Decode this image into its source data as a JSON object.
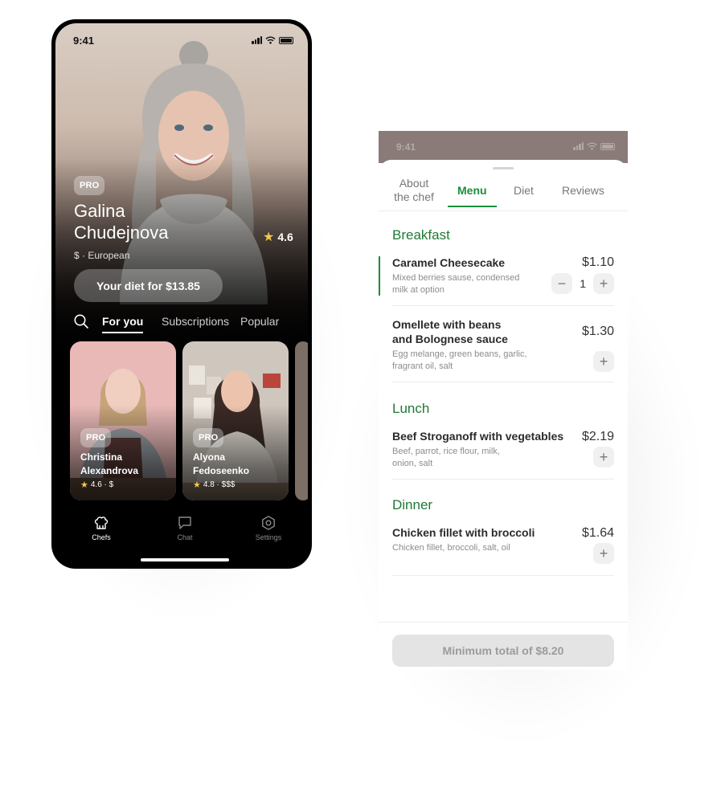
{
  "chef_app": {
    "status": {
      "time": "9:41"
    },
    "hero": {
      "badge": "PRO",
      "name": "Galina\nChudejnova",
      "rating": "4.6",
      "meta": "$ · European",
      "diet_button": "Your diet for $13.85"
    },
    "feed_tabs": [
      "For you",
      "Subscriptions",
      "Popular"
    ],
    "cards": [
      {
        "badge": "PRO",
        "name": "Christina\nAlexandrova",
        "meta": "4.6 · $"
      },
      {
        "badge": "PRO",
        "name": "Alyona\nFedoseenko",
        "meta": "4.8 · $$$"
      }
    ],
    "tabbar": [
      {
        "label": "Chefs",
        "icon": "chef-hat-icon"
      },
      {
        "label": "Chat",
        "icon": "chat-icon"
      },
      {
        "label": "Settings",
        "icon": "settings-icon"
      }
    ]
  },
  "menu_app": {
    "status": {
      "time": "9:41"
    },
    "tabs": {
      "about": "About\nthe chef",
      "menu": "Menu",
      "diet": "Diet",
      "reviews": "Reviews"
    },
    "sections": {
      "breakfast": "Breakfast",
      "lunch": "Lunch",
      "dinner": "Dinner"
    },
    "dishes": [
      {
        "name": "Caramel Cheesecake",
        "desc": "Mixed berries sause, condensed\nmilk at option",
        "price": "$1.10",
        "qty": "1"
      },
      {
        "name": "Omellete with beans\nand Bolognese sauce",
        "desc": "Egg melange, green beans, garlic,\nfragrant oil, salt",
        "price": "$1.30"
      },
      {
        "name": "Beef Stroganoff with vegetables",
        "desc": "Beef, parrot, rice flour, milk,\nonion, salt",
        "price": "$2.19"
      },
      {
        "name": "Chicken fillet with broccoli",
        "desc": "Chicken fillet, broccoli, salt, oil",
        "price": "$1.64"
      }
    ],
    "minimum_button": "Minimum total of $8.20"
  },
  "colors": {
    "accent_green": "#1a8e3d",
    "section_green": "#1f7a34",
    "star": "#f2c94c"
  }
}
